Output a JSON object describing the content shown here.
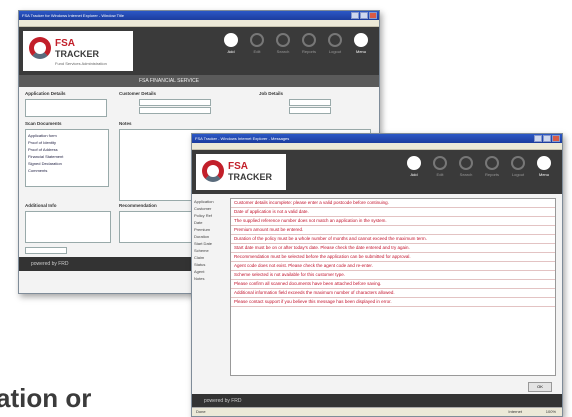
{
  "back": {
    "title": "FSA Tracker for Windows Internet Explorer - Window Title",
    "logo": {
      "line1": "FSA",
      "line2": "TRACKER",
      "tag": "Fund Services Administration"
    },
    "nav": [
      {
        "label": "Add",
        "active": true
      },
      {
        "label": "Edit",
        "active": false
      },
      {
        "label": "Search",
        "active": false
      },
      {
        "label": "Reports",
        "active": false
      },
      {
        "label": "Logout",
        "active": false
      },
      {
        "label": "Menu",
        "active": true
      }
    ],
    "subheader": "FSA FINANCIAL SERVICE",
    "sections": {
      "application": "Application Details",
      "customer": "Customer Details",
      "job": "Job Details",
      "scan": "Scan Documents",
      "notes": "Notes",
      "additional": "Additional Info",
      "recommendation": "Recommendation"
    },
    "scan_items": [
      "Application form",
      "Proof of Identity",
      "Proof of Address",
      "Financial Statement",
      "Signed Declaration",
      "Comments"
    ],
    "footer": "powered by FRD"
  },
  "front": {
    "title": "FSA Tracker - Windows Internet Explorer - Messages",
    "logo": {
      "line1": "FSA",
      "line2": "TRACKER"
    },
    "nav": [
      {
        "label": "Add",
        "active": true
      },
      {
        "label": "Edit",
        "active": false
      },
      {
        "label": "Search",
        "active": false
      },
      {
        "label": "Reports",
        "active": false
      },
      {
        "label": "Logout",
        "active": false
      },
      {
        "label": "Menu",
        "active": true
      }
    ],
    "side_labels": [
      "Application",
      "Customer",
      "Policy Ref",
      "Date",
      "Premium",
      "Duration",
      "Start Date",
      "Scheme",
      "Claim",
      "Status",
      "Agent",
      "Notes"
    ],
    "messages": [
      "Customer details incomplete: please enter a valid postcode before continuing.",
      "Date of application is not a valid date.",
      "The supplied reference number does not match an application in the system.",
      "Premium amount must be entered.",
      "Duration of the policy must be a whole number of months and cannot exceed the maximum term.",
      "Start date must be on or after today's date. Please check the date entered and try again.",
      "Recommendation must be selected before the application can be submitted for approval.",
      "Agent code does not exist. Please check the agent code and re-enter.",
      "Scheme selected is not available for this customer type.",
      "Please confirm all scanned documents have been attached before saving.",
      "Additional information field exceeds the maximum number of characters allowed.",
      "Please contact support if you believe this message has been displayed in error."
    ],
    "ok_label": "OK",
    "footer": "powered by FRD",
    "status": {
      "left": "Done",
      "zone": "Internet",
      "zoom": "100%"
    }
  },
  "caption": "ation or"
}
